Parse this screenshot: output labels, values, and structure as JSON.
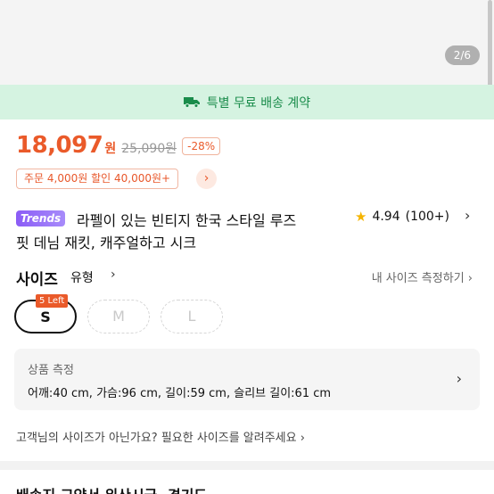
{
  "image": {
    "counter": "2/6"
  },
  "shipping": {
    "text": "특별 무료 배송 계약"
  },
  "price": {
    "sale": "18,097",
    "unit": "원",
    "original": "25,090원",
    "discount": "-28%"
  },
  "coupon": {
    "text": "주문 4,000원 할인 40,000원+",
    "arrow": "›"
  },
  "product": {
    "badge": "Trends",
    "title_line1": "라펠이 있는 빈티지 한국 스타일 루즈",
    "title_line2": "핏 데님 재킷, 캐주얼하고 시크",
    "rating": "4.94",
    "review_count": "(100+)"
  },
  "size": {
    "heading": "사이즈",
    "type_label": "유형",
    "measure_link": "내 사이즈 측정하기",
    "options": [
      "S",
      "M",
      "L"
    ],
    "stock_badge": "5 Left"
  },
  "measurements": {
    "title": "상품 측정",
    "items": [
      {
        "label": "어깨:",
        "value": "40 cm,"
      },
      {
        "label": "가슴:",
        "value": "96 cm,"
      },
      {
        "label": "길이:",
        "value": "59 cm,"
      },
      {
        "label": "슬리브 길이:",
        "value": "61 cm"
      }
    ]
  },
  "feedback": {
    "text": "고객님의 사이즈가 아닌가요? 필요한 사이즈를 알려주세요 ›"
  },
  "next_section": {
    "title": "배송지 교약서 위산시급, 경기도"
  },
  "icons": {
    "truck": "truck-icon",
    "star": "star-icon",
    "chevron": "chevron-right-icon"
  },
  "colors": {
    "accent": "#ea5a2a",
    "shipping_bg": "#d5f3e1",
    "shipping_text": "#1a8c4b",
    "badge": "#8b5cf6",
    "star": "#f5b400"
  }
}
